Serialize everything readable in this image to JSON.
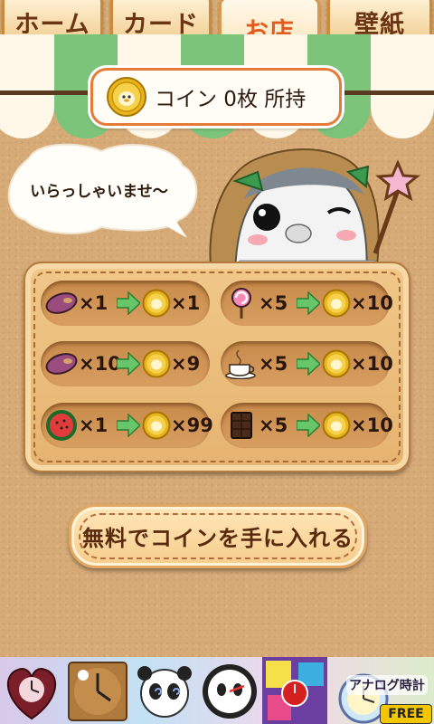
{
  "tabs": [
    {
      "label": "ホーム",
      "active": false
    },
    {
      "label": "カード",
      "active": false
    },
    {
      "label": "お店",
      "active": true
    },
    {
      "label": "壁紙",
      "active": false
    }
  ],
  "coin_banner": {
    "text": "コイン 0枚 所持"
  },
  "greeting": "いらっしゃいませ〜",
  "exchange": [
    {
      "item_icon": "sweet-potato-icon",
      "qty": "×1",
      "reward": "×1"
    },
    {
      "item_icon": "lollipop-icon",
      "qty": "×5",
      "reward": "×10"
    },
    {
      "item_icon": "sweet-potato-icon",
      "qty": "×10",
      "reward": "×9"
    },
    {
      "item_icon": "coffee-cup-icon",
      "qty": "×5",
      "reward": "×10"
    },
    {
      "item_icon": "watermelon-icon",
      "qty": "×1",
      "reward": "×99"
    },
    {
      "item_icon": "chocolate-icon",
      "qty": "×5",
      "reward": "×10"
    }
  ],
  "free_coin_button": "無料でコインを手に入れる",
  "ad": {
    "label": "アナログ時計",
    "badge": "FREE"
  },
  "colors": {
    "accent": "#e25a1c",
    "tab_text": "#6b3412",
    "board": "#e6b36f",
    "awning_green": "#7cc47a"
  }
}
